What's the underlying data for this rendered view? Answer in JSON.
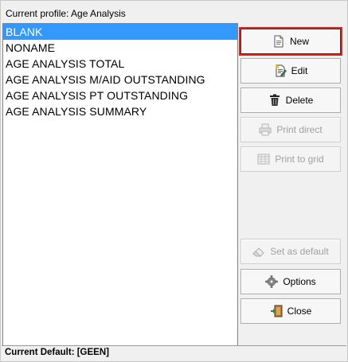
{
  "header": {
    "profile_label": "Current profile: Age Analysis"
  },
  "list": {
    "items": [
      {
        "label": "BLANK",
        "selected": true
      },
      {
        "label": "NONAME",
        "selected": false
      },
      {
        "label": "AGE ANALYSIS TOTAL",
        "selected": false
      },
      {
        "label": "AGE ANALYSIS M/AID OUTSTANDING",
        "selected": false
      },
      {
        "label": "AGE ANALYSIS PT OUTSTANDING",
        "selected": false
      },
      {
        "label": "AGE ANALYSIS SUMMARY",
        "selected": false
      }
    ],
    "selection_color": "#3399ff"
  },
  "buttons": {
    "new": {
      "label": "New",
      "icon": "new-document-icon",
      "enabled": true,
      "highlighted": true
    },
    "edit": {
      "label": "Edit",
      "icon": "edit-document-icon",
      "enabled": true
    },
    "delete": {
      "label": "Delete",
      "icon": "trash-icon",
      "enabled": true
    },
    "print_direct": {
      "label": "Print direct",
      "icon": "printer-icon",
      "enabled": false
    },
    "print_to_grid": {
      "label": "Print to grid",
      "icon": "grid-icon",
      "enabled": false
    },
    "set_as_default": {
      "label": "Set as default",
      "icon": "eraser-icon",
      "enabled": false
    },
    "options": {
      "label": "Options",
      "icon": "gear-icon",
      "enabled": true
    },
    "close": {
      "label": "Close",
      "icon": "exit-door-icon",
      "enabled": true
    }
  },
  "status": {
    "text": "Current Default: [GEEN]"
  },
  "colors": {
    "highlight_outline": "#e2231a",
    "disabled_text": "#a0a0a0"
  }
}
